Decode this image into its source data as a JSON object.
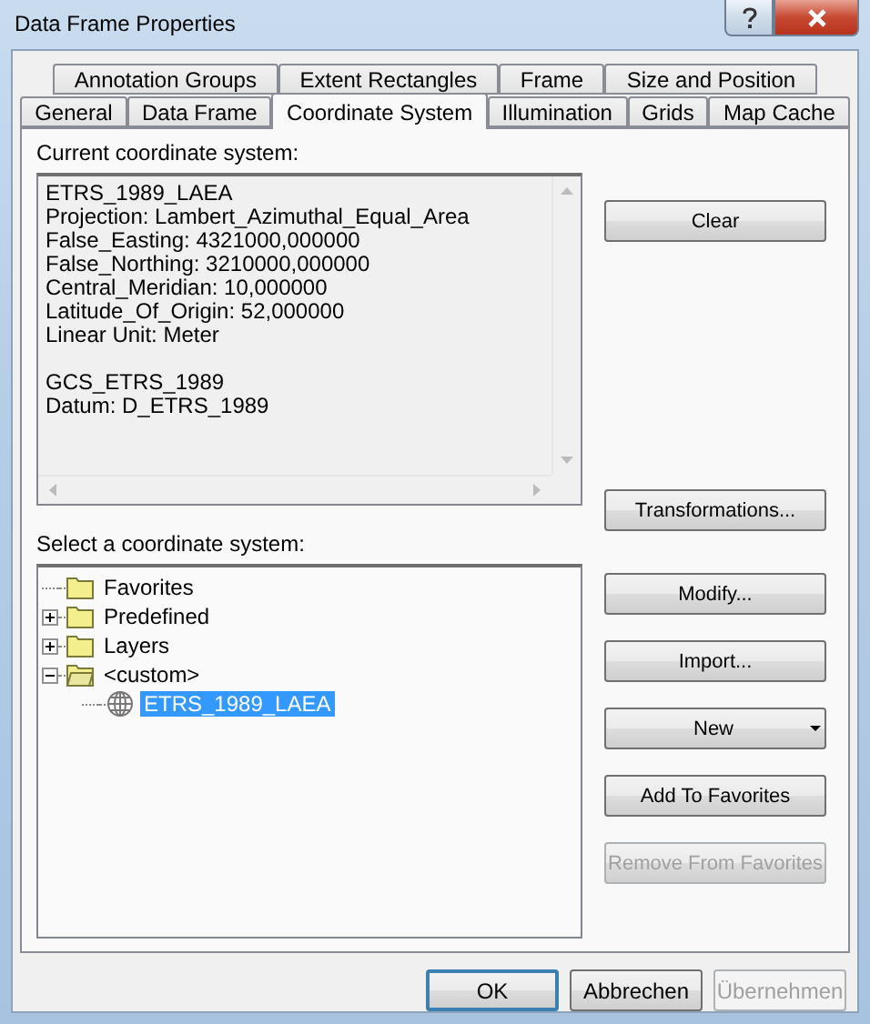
{
  "window": {
    "title": "Data Frame Properties"
  },
  "tab_rows": [
    {
      "tabs": [
        {
          "label": "Annotation Groups",
          "selected": false
        },
        {
          "label": "Extent Rectangles",
          "selected": false
        },
        {
          "label": "Frame",
          "selected": false
        },
        {
          "label": "Size and Position",
          "selected": false
        }
      ]
    },
    {
      "tabs": [
        {
          "label": "General",
          "selected": false
        },
        {
          "label": "Data Frame",
          "selected": false
        },
        {
          "label": "Coordinate System",
          "selected": true
        },
        {
          "label": "Illumination",
          "selected": false
        },
        {
          "label": "Grids",
          "selected": false
        },
        {
          "label": "Map Cache",
          "selected": false
        }
      ]
    }
  ],
  "current": {
    "label": "Current coordinate system:",
    "paragraphs": [
      [
        "ETRS_1989_LAEA",
        "Projection: Lambert_Azimuthal_Equal_Area",
        "False_Easting: 4321000,000000",
        "False_Northing: 3210000,000000",
        "Central_Meridian: 10,000000",
        "Latitude_Of_Origin: 52,000000",
        "Linear Unit: Meter"
      ],
      [
        "GCS_ETRS_1989",
        "Datum: D_ETRS_1989"
      ]
    ]
  },
  "select": {
    "label": "Select a coordinate system:",
    "tree": [
      {
        "label": "Favorites",
        "kind": "folder",
        "selected": false
      },
      {
        "label": "Predefined",
        "kind": "folder",
        "expanded": false,
        "selected": false
      },
      {
        "label": "Layers",
        "kind": "folder",
        "expanded": false,
        "selected": false
      },
      {
        "label": "<custom>",
        "kind": "folder",
        "expanded": true,
        "selected": false,
        "children": [
          {
            "label": "ETRS_1989_LAEA",
            "kind": "projection",
            "selected": true
          }
        ]
      }
    ]
  },
  "side_buttons": [
    {
      "label": "Clear",
      "kind": "plain",
      "disabled": false
    },
    {
      "label": "Transformations...",
      "kind": "plain",
      "disabled": false
    },
    {
      "label": "Modify...",
      "kind": "plain",
      "disabled": false
    },
    {
      "label": "Import...",
      "kind": "plain",
      "disabled": false
    },
    {
      "label": "New",
      "kind": "dropdown",
      "disabled": false
    },
    {
      "label": "Add To Favorites",
      "kind": "plain",
      "disabled": false
    },
    {
      "label": "Remove From Favorites",
      "kind": "plain",
      "disabled": true
    }
  ],
  "footer_buttons": [
    {
      "label": "OK",
      "default": true,
      "disabled": false
    },
    {
      "label": "Abbrechen",
      "default": false,
      "disabled": false
    },
    {
      "label": "Übernehmen",
      "default": false,
      "disabled": true
    }
  ]
}
